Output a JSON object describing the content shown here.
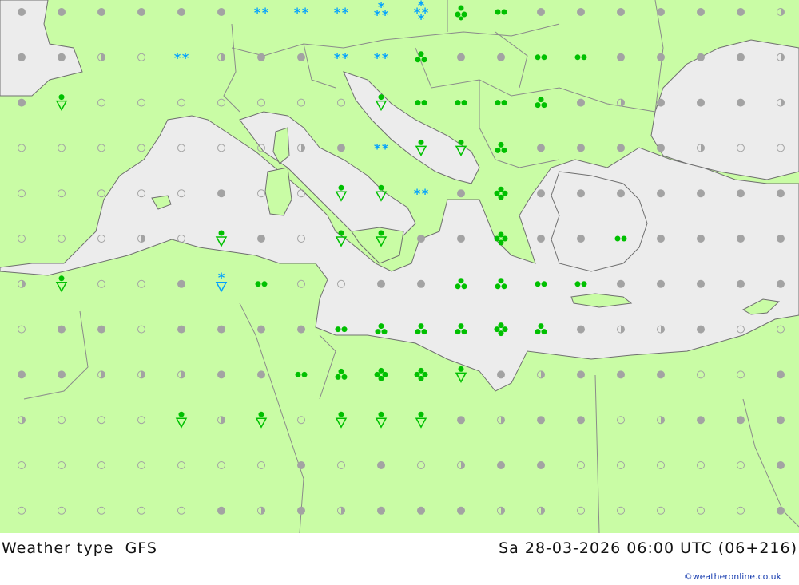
{
  "map": {
    "title": "Weather type",
    "model": "GFS",
    "valid_time": "Sa 28-03-2026 06:00 UTC (06+216)",
    "credit": "©weatheronline.co.uk"
  },
  "colors": {
    "sea": "#ececec",
    "land": "#c9fca5",
    "border": "#8a8a8a",
    "coast": "#6f6f6f",
    "dot_gray": "#a3a3a3",
    "rain_green": "#00c000",
    "snow_blue": "#00a0ff"
  },
  "legend_symbols": {
    "fair": "filled grey dot",
    "partly_cloudy": "half-filled grey dot",
    "clear": "open grey circle",
    "drizzle": "two green dots",
    "rain": "three green dots",
    "heavy_rain": "four green dots",
    "rain_shower": "green dot over triangle",
    "snow": "two blue asterisks",
    "heavy_snow": "three blue asterisks",
    "snow_shower": "blue asterisk over triangle",
    "thunderstorm": "green dot over two dots"
  },
  "grid": {
    "columns": 20,
    "rows": 12,
    "symbols": [
      [
        "F",
        "F",
        "F",
        "F",
        "F",
        "F",
        "SN",
        "SN",
        "SN",
        "HSN",
        "HSN2",
        "TS",
        "DZ",
        "F",
        "F",
        "F",
        "F",
        "F",
        "F",
        "P"
      ],
      [
        "F",
        "F",
        "P",
        "C",
        "SN",
        "P",
        "F",
        "F",
        "SN",
        "SN",
        "R",
        "F",
        "F",
        "DZ",
        "DZ",
        "F",
        "F",
        "F",
        "F",
        "P"
      ],
      [
        "F",
        "SH",
        "C",
        "C",
        "C",
        "C",
        "C",
        "C",
        "C",
        "SH",
        "DZ",
        "DZ",
        "DZ",
        "R",
        "F",
        "P",
        "F",
        "F",
        "F",
        "P"
      ],
      [
        "C",
        "C",
        "C",
        "C",
        "C",
        "C",
        "C",
        "P",
        "F",
        "SN",
        "SH",
        "SH",
        "R",
        "F",
        "F",
        "F",
        "F",
        "P",
        "C",
        "C"
      ],
      [
        "C",
        "C",
        "C",
        "C",
        "C",
        "F",
        "C",
        "C",
        "SH",
        "SH",
        "SN",
        "F",
        "HR",
        "F",
        "F",
        "F",
        "F",
        "F",
        "F",
        "F"
      ],
      [
        "C",
        "C",
        "C",
        "P",
        "C",
        "SH",
        "F",
        "C",
        "SH",
        "SH",
        "F",
        "F",
        "HR",
        "F",
        "F",
        "DZ",
        "F",
        "F",
        "F",
        "F"
      ],
      [
        "P",
        "SH",
        "C",
        "C",
        "F",
        "SSH",
        "DZ",
        "C",
        "C",
        "F",
        "F",
        "R",
        "R",
        "DZ",
        "DZ",
        "F",
        "F",
        "F",
        "F",
        "F"
      ],
      [
        "C",
        "F",
        "F",
        "C",
        "F",
        "F",
        "F",
        "F",
        "DZ",
        "R",
        "R",
        "R",
        "HR",
        "R",
        "F",
        "P",
        "P",
        "F",
        "C",
        "C"
      ],
      [
        "F",
        "F",
        "P",
        "P",
        "P",
        "F",
        "F",
        "DZ",
        "R",
        "HR",
        "HR",
        "SH",
        "F",
        "P",
        "F",
        "F",
        "F",
        "C",
        "C",
        "F"
      ],
      [
        "P",
        "C",
        "C",
        "C",
        "SH",
        "P",
        "SH",
        "C",
        "SH",
        "SH",
        "SH",
        "F",
        "P",
        "F",
        "F",
        "C",
        "P",
        "F",
        "F",
        "F"
      ],
      [
        "C",
        "C",
        "C",
        "C",
        "C",
        "C",
        "C",
        "F",
        "C",
        "F",
        "C",
        "P",
        "F",
        "F",
        "C",
        "C",
        "C",
        "C",
        "C",
        "F"
      ],
      [
        "C",
        "C",
        "C",
        "C",
        "C",
        "F",
        "P",
        "F",
        "P",
        "F",
        "F",
        "F",
        "P",
        "P",
        "C",
        "C",
        "C",
        "C",
        "C",
        "F"
      ]
    ]
  }
}
